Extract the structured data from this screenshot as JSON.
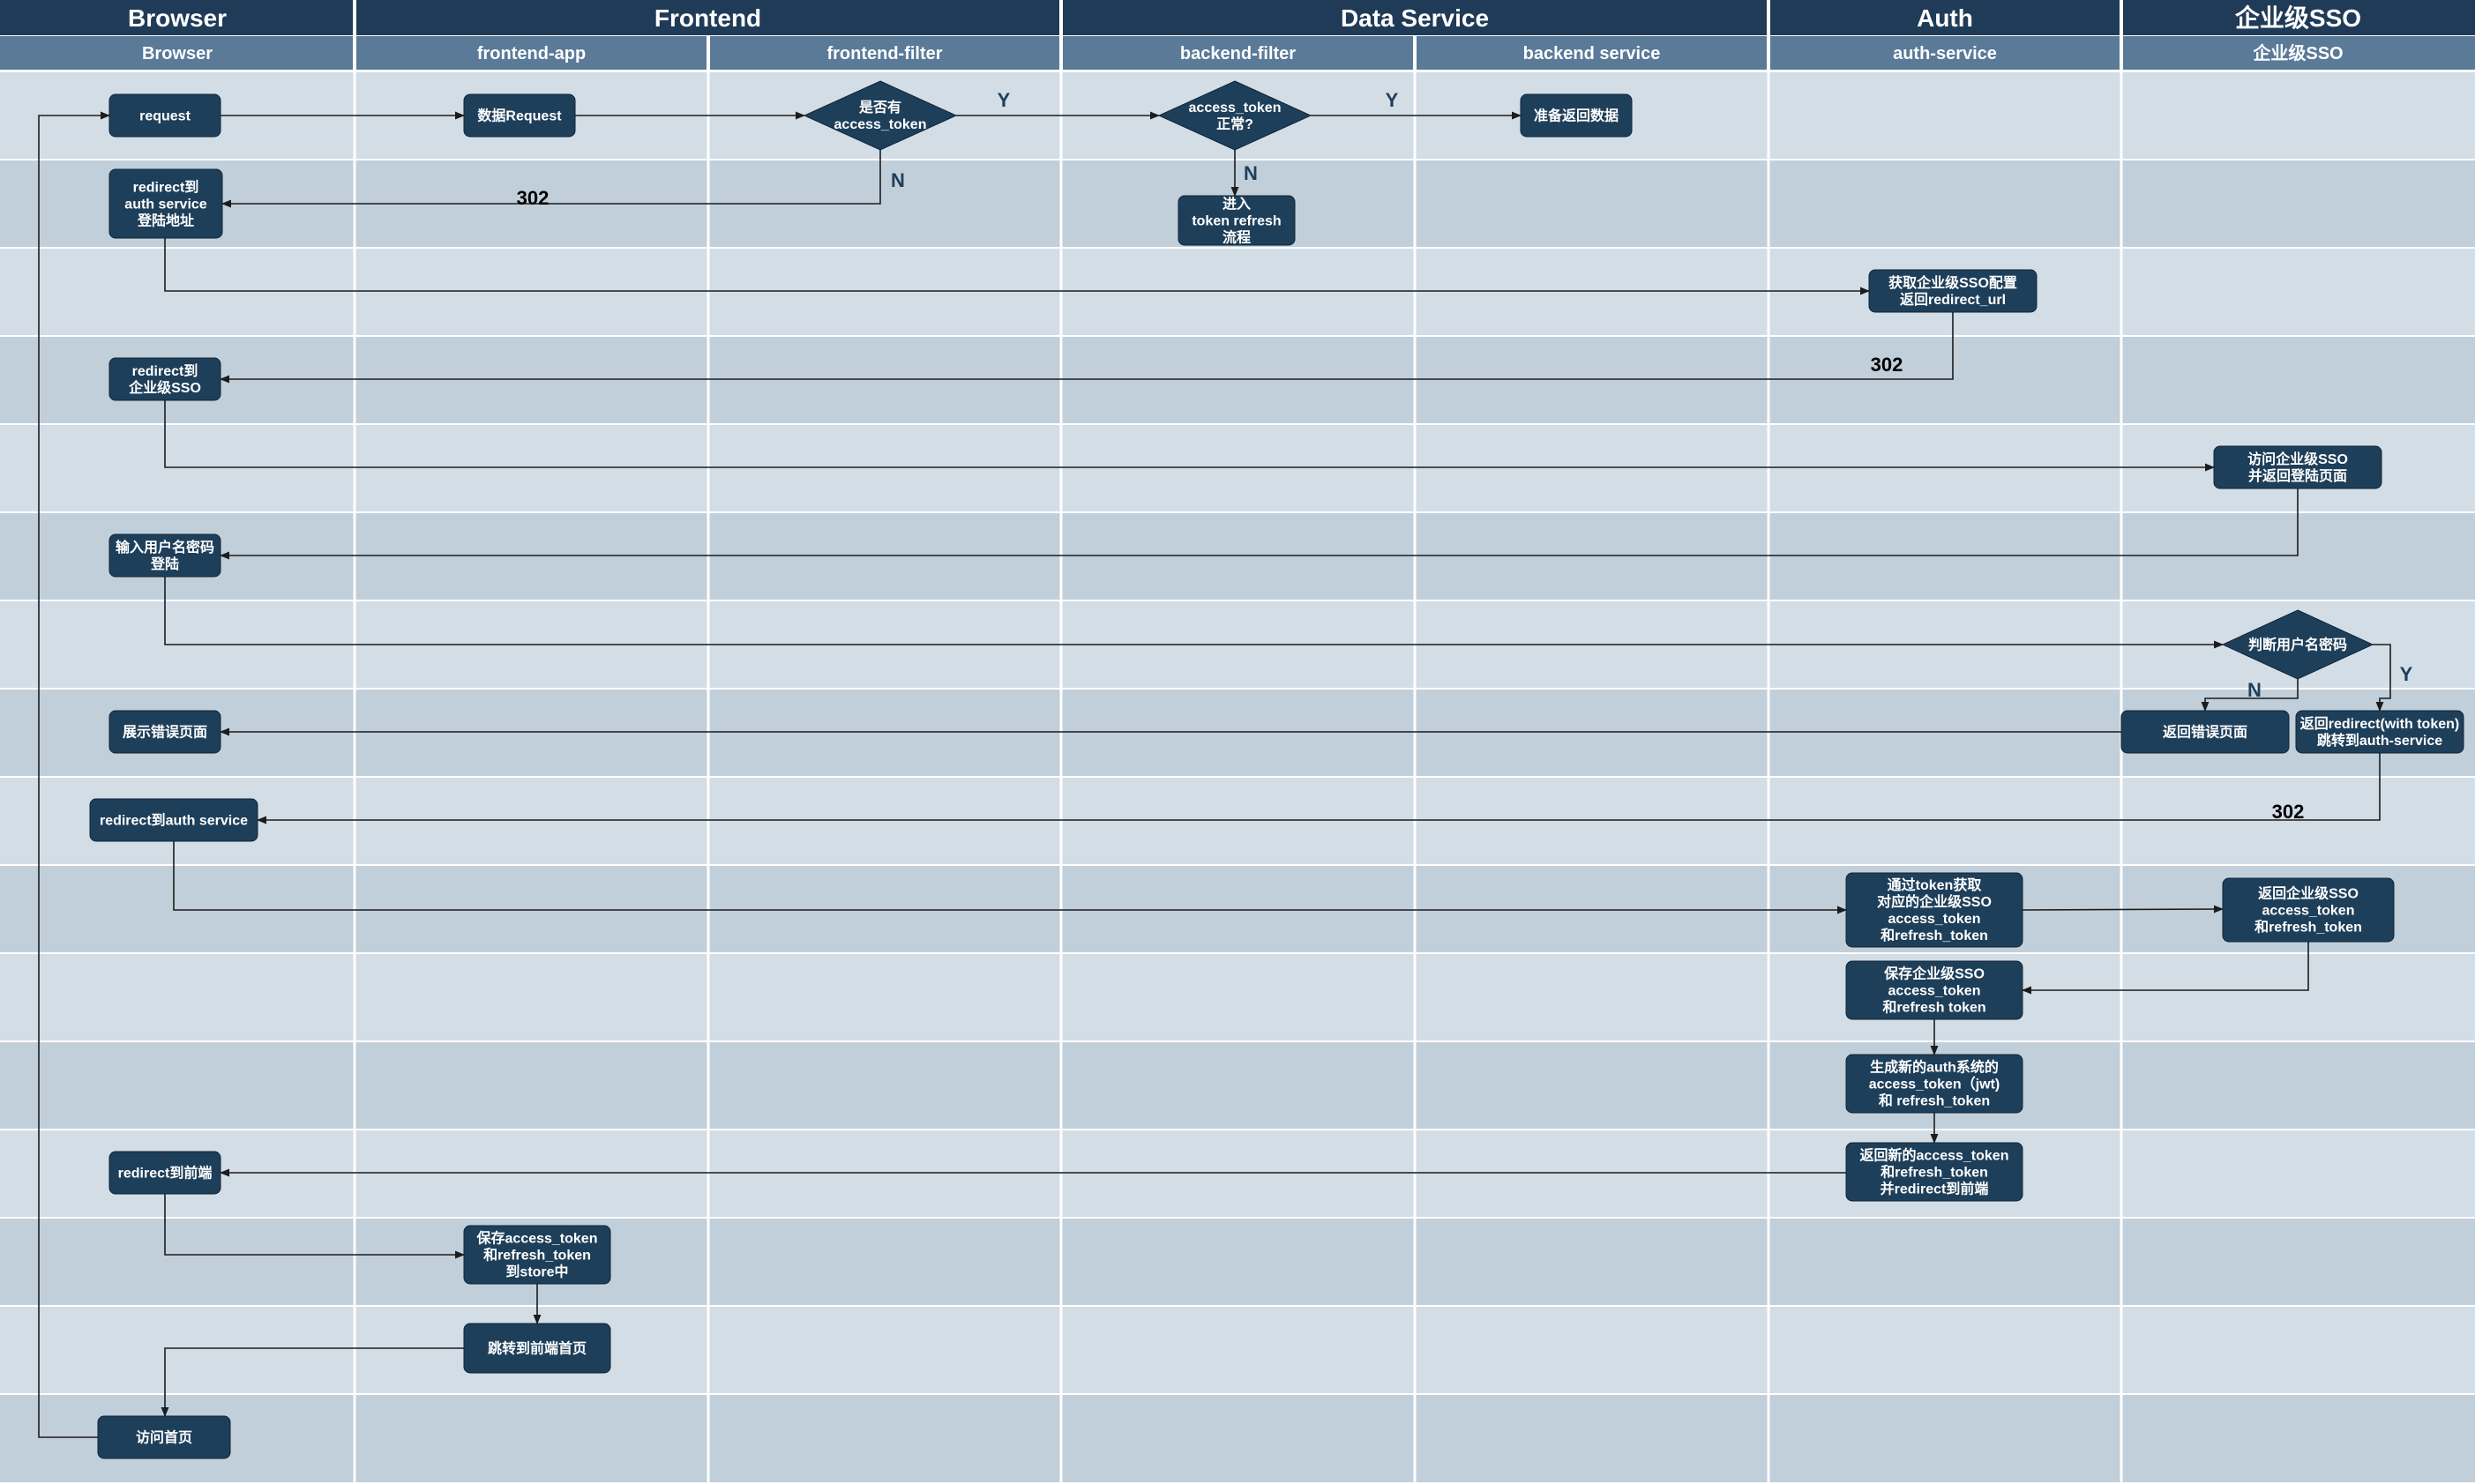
{
  "groups": [
    {
      "id": "browser",
      "label": "Browser"
    },
    {
      "id": "frontend",
      "label": "Frontend"
    },
    {
      "id": "data",
      "label": "Data Service"
    },
    {
      "id": "auth",
      "label": "Auth"
    },
    {
      "id": "sso",
      "label": "企业级SSO"
    }
  ],
  "lanes": [
    {
      "id": "browser",
      "label": "Browser"
    },
    {
      "id": "frontend-app",
      "label": "frontend-app"
    },
    {
      "id": "frontend-filter",
      "label": "frontend-filter"
    },
    {
      "id": "backend-filter",
      "label": "backend-filter"
    },
    {
      "id": "backend-service",
      "label": "backend service"
    },
    {
      "id": "auth-service",
      "label": "auth-service"
    },
    {
      "id": "sso",
      "label": "企业级SSO"
    }
  ],
  "nodes": [
    {
      "id": "request",
      "lines": [
        "request"
      ]
    },
    {
      "id": "data-request",
      "lines": [
        "数据Request"
      ]
    },
    {
      "id": "has-token",
      "lines": [
        "是否有",
        "access_token"
      ]
    },
    {
      "id": "token-ok",
      "lines": [
        "access_token",
        "正常?"
      ]
    },
    {
      "id": "return-data",
      "lines": [
        "准备返回数据"
      ]
    },
    {
      "id": "redirect-auth-login",
      "lines": [
        "redirect到",
        "auth service",
        "登陆地址"
      ]
    },
    {
      "id": "token-refresh",
      "lines": [
        "进入",
        "token refresh",
        "流程"
      ]
    },
    {
      "id": "get-sso-config",
      "lines": [
        "获取企业级SSO配置",
        "返回redirect_url"
      ]
    },
    {
      "id": "redirect-sso",
      "lines": [
        "redirect到",
        "企业级SSO"
      ]
    },
    {
      "id": "visit-sso",
      "lines": [
        "访问企业级SSO",
        "并返回登陆页面"
      ]
    },
    {
      "id": "input-credentials",
      "lines": [
        "输入用户名密码",
        "登陆"
      ]
    },
    {
      "id": "check-credentials",
      "lines": [
        "判断用户名密码"
      ]
    },
    {
      "id": "show-error",
      "lines": [
        "展示错误页面"
      ]
    },
    {
      "id": "return-error",
      "lines": [
        "返回错误页面"
      ]
    },
    {
      "id": "return-redirect",
      "lines": [
        "返回redirect(with token)",
        "跳转到auth-service"
      ]
    },
    {
      "id": "redirect-auth",
      "lines": [
        "redirect到auth service"
      ]
    },
    {
      "id": "get-sso-token",
      "lines": [
        "通过token获取",
        "对应的企业级SSO",
        "access_token",
        "和refresh_token"
      ]
    },
    {
      "id": "return-sso-token",
      "lines": [
        "返回企业级SSO",
        "access_token",
        "和refresh_token"
      ]
    },
    {
      "id": "save-sso-token",
      "lines": [
        "保存企业级SSO",
        "access_token",
        "和refresh token"
      ]
    },
    {
      "id": "gen-auth-token",
      "lines": [
        "生成新的auth系统的",
        "access_token（jwt)",
        "和 refresh_token"
      ]
    },
    {
      "id": "return-new-token",
      "lines": [
        "返回新的access_token",
        "和refresh_token",
        "并redirect到前端"
      ]
    },
    {
      "id": "redirect-frontend",
      "lines": [
        "redirect到前端"
      ]
    },
    {
      "id": "save-store",
      "lines": [
        "保存access_token",
        "和refresh_token",
        "到store中"
      ]
    },
    {
      "id": "goto-home",
      "lines": [
        "跳转到前端首页"
      ]
    },
    {
      "id": "visit-home",
      "lines": [
        "访问首页"
      ]
    }
  ],
  "edge_labels": {
    "code_302": "302",
    "yes": "Y",
    "no": "N"
  },
  "colors": {
    "header_bg": "#1f3b57",
    "sublane_bg": "#5a7a98",
    "row_light": "#d3dde6",
    "row_dark": "#c1cfda",
    "node_fill": "#1e3f5a",
    "divider": "#ffffff",
    "edge": "#1c1c1c"
  }
}
